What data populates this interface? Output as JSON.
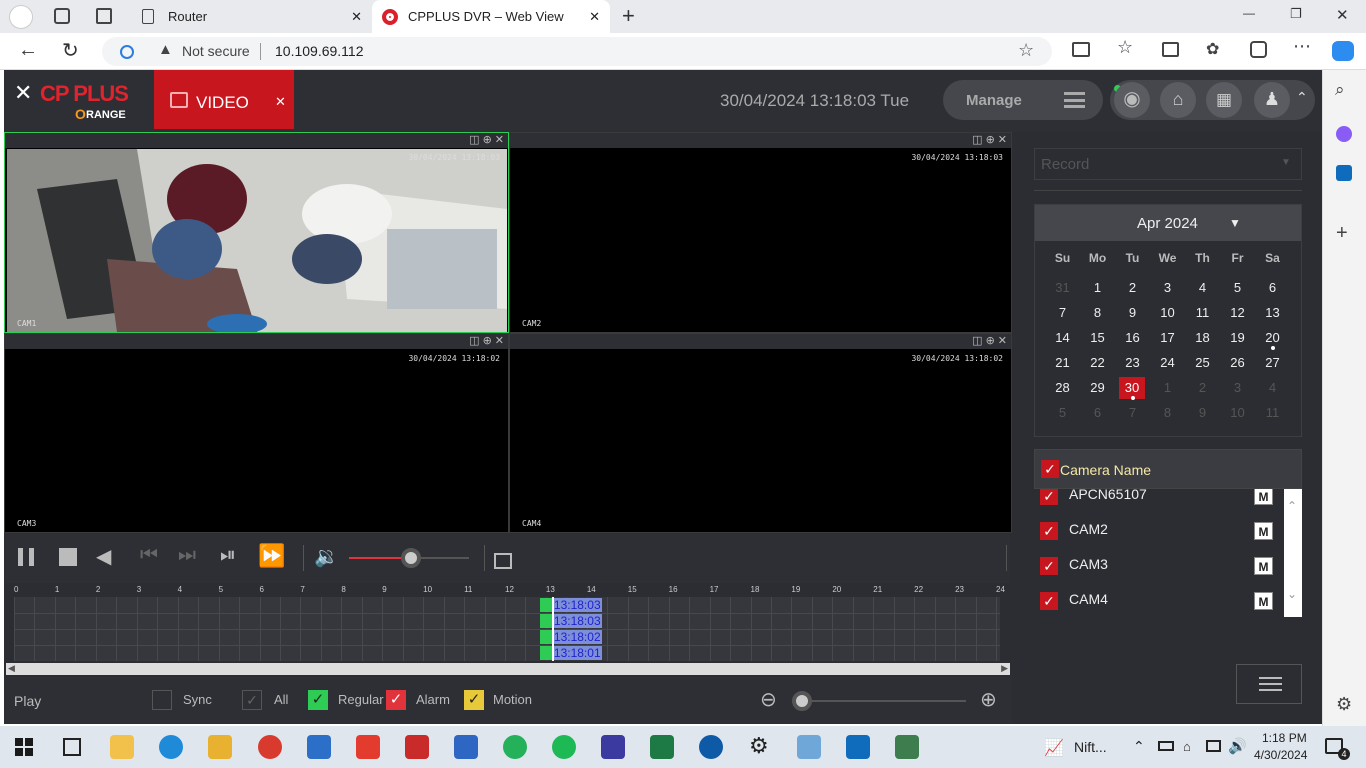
{
  "browser": {
    "tabs": [
      {
        "title": "Router",
        "close": "✕"
      },
      {
        "title": "CPPLUS DVR – Web View",
        "close": "✕"
      }
    ],
    "new_tab": "+",
    "window_controls": {
      "minimize": "—",
      "maximize": "❐",
      "close": "✕"
    },
    "not_secure": "Not secure",
    "url": "10.109.69.112"
  },
  "app": {
    "logo_text": "CP PLUS",
    "logo_sub": "RANGE",
    "logo_sub_o": "O",
    "video_tab": "VIDEO",
    "video_close": "✕",
    "datetime": "30/04/2024 13:18:03 Tue",
    "manage": "Manage"
  },
  "video": {
    "panes": [
      {
        "label": "CAM1",
        "ts": "30/04/2024 13:18:03"
      },
      {
        "label": "CAM2",
        "ts": "30/04/2024 13:18:03"
      },
      {
        "label": "CAM3",
        "ts": "30/04/2024 13:18:02"
      },
      {
        "label": "CAM4",
        "ts": "30/04/2024 13:18:02"
      }
    ],
    "volume_percent": 52
  },
  "timeline": {
    "hours": [
      "0",
      "1",
      "2",
      "3",
      "4",
      "5",
      "6",
      "7",
      "8",
      "9",
      "10",
      "11",
      "12",
      "13",
      "14",
      "15",
      "16",
      "17",
      "18",
      "19",
      "20",
      "21",
      "22",
      "23",
      "24"
    ],
    "marks": [
      "13:18:03",
      "13:18:03",
      "13:18:02",
      "13:18:01"
    ]
  },
  "bottom": {
    "play": "Play",
    "sync": "Sync",
    "all": "All",
    "regular": "Regular",
    "alarm": "Alarm",
    "motion": "Motion",
    "colors": {
      "regular": "#2ecc55",
      "alarm": "#e0333c",
      "motion": "#e8c93a"
    }
  },
  "right": {
    "record_placeholder": "Record",
    "month": "Apr 2024",
    "weekdays": [
      "Su",
      "Mo",
      "Tu",
      "We",
      "Th",
      "Fr",
      "Sa"
    ],
    "weeks": [
      [
        "31",
        "1",
        "2",
        "3",
        "4",
        "5",
        "6"
      ],
      [
        "7",
        "8",
        "9",
        "10",
        "11",
        "12",
        "13"
      ],
      [
        "14",
        "15",
        "16",
        "17",
        "18",
        "19",
        "20"
      ],
      [
        "21",
        "22",
        "23",
        "24",
        "25",
        "26",
        "27"
      ],
      [
        "28",
        "29",
        "30",
        "1",
        "2",
        "3",
        "4"
      ],
      [
        "5",
        "6",
        "7",
        "8",
        "9",
        "10",
        "11"
      ]
    ],
    "camera_header": "Camera Name",
    "cameras": [
      "APCN65107",
      "CAM2",
      "CAM3",
      "CAM4"
    ],
    "m_label": "M"
  },
  "taskbar": {
    "stock": "Nift...",
    "time": "1:18 PM",
    "date": "4/30/2024",
    "notif_count": "4"
  }
}
